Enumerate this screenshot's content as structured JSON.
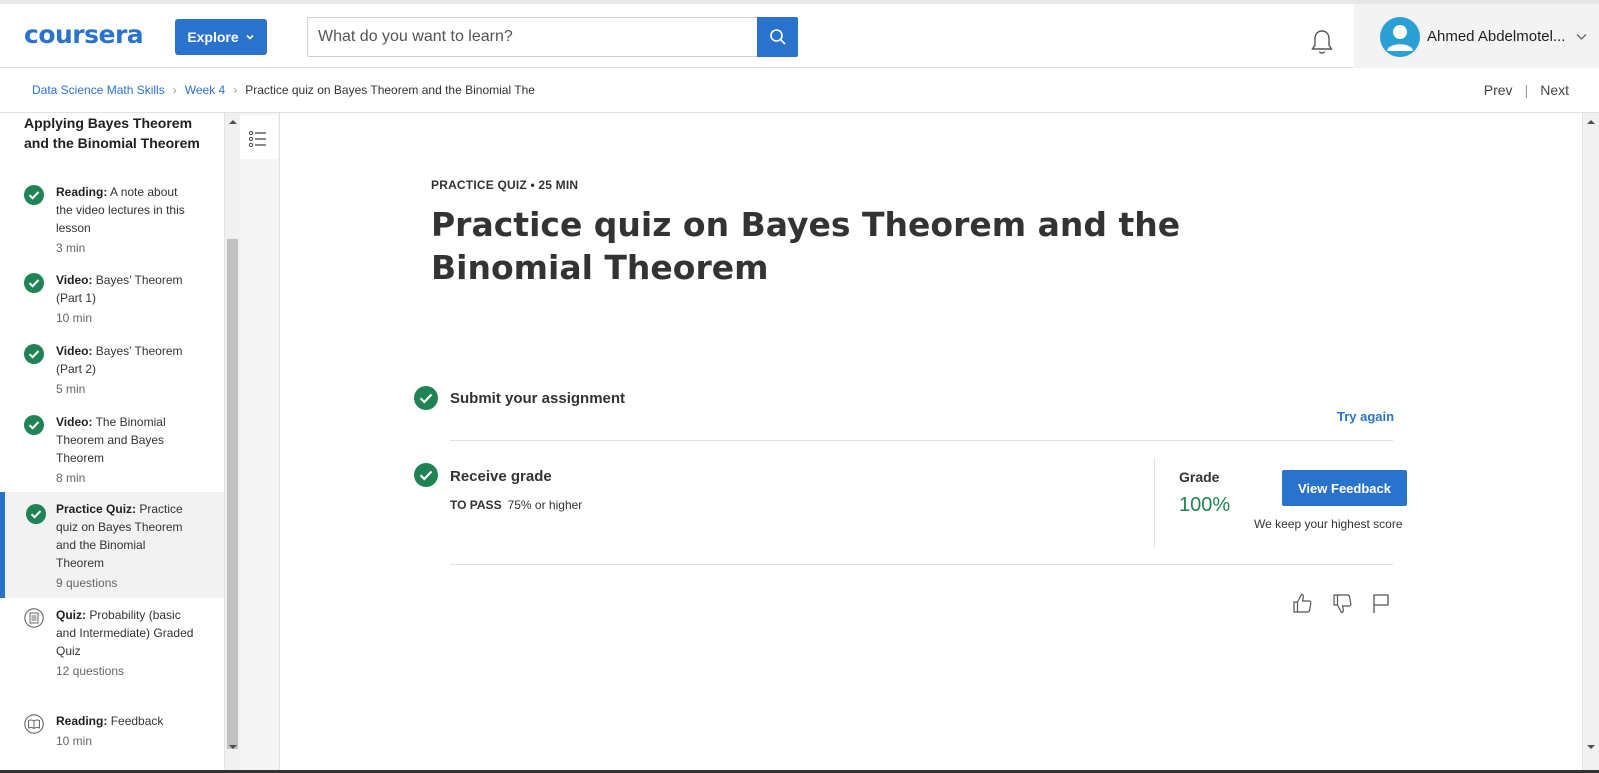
{
  "header": {
    "logo": "coursera",
    "explore_label": "Explore",
    "search_placeholder": "What do you want to learn?",
    "user_name": "Ahmed Abdelmotel..."
  },
  "breadcrumb": {
    "items": [
      "Data Science Math Skills",
      "Week 4",
      "Practice quiz on Bayes Theorem and the Binomial The"
    ],
    "prev": "Prev",
    "next": "Next"
  },
  "sidebar": {
    "title": "Applying Bayes Theorem and the Binomial Theorem",
    "items": [
      {
        "type": "Reading:",
        "name": "A note about the video lectures in this lesson",
        "meta": "3 min",
        "status": "completed",
        "icon": "check-icon"
      },
      {
        "type": "Video:",
        "name": "Bayes’ Theorem (Part 1)",
        "meta": "10 min",
        "status": "completed",
        "icon": "check-icon"
      },
      {
        "type": "Video:",
        "name": "Bayes’ Theorem (Part 2)",
        "meta": "5 min",
        "status": "completed",
        "icon": "check-icon"
      },
      {
        "type": "Video:",
        "name": "The Binomial Theorem and Bayes Theorem",
        "meta": "8 min",
        "status": "completed",
        "icon": "check-icon"
      },
      {
        "type": "Practice Quiz:",
        "name": "Practice quiz on Bayes Theorem and the Binomial Theorem",
        "meta": "9 questions",
        "status": "completed",
        "icon": "check-icon"
      },
      {
        "type": "Quiz:",
        "name": "Probability (basic and Intermediate) Graded Quiz",
        "meta": "12 questions",
        "status": "pending",
        "icon": "quiz-icon"
      },
      {
        "type": "Reading:",
        "name": "Feedback",
        "meta": "10 min",
        "status": "pending",
        "icon": "reading-icon"
      }
    ]
  },
  "main": {
    "kicker": "PRACTICE QUIZ • 25 MIN",
    "title": "Practice quiz on Bayes Theorem and the Binomial Theorem",
    "submit_label": "Submit your assignment",
    "try_again": "Try again",
    "receive_label": "Receive grade",
    "to_pass_label": "TO PASS",
    "to_pass_value": "75% or higher",
    "grade_label": "Grade",
    "grade_value": "100%",
    "view_feedback": "View Feedback",
    "keep_note": "We keep your highest score"
  },
  "colors": {
    "brand_blue": "#2a73cc",
    "success_green": "#1f8354"
  }
}
